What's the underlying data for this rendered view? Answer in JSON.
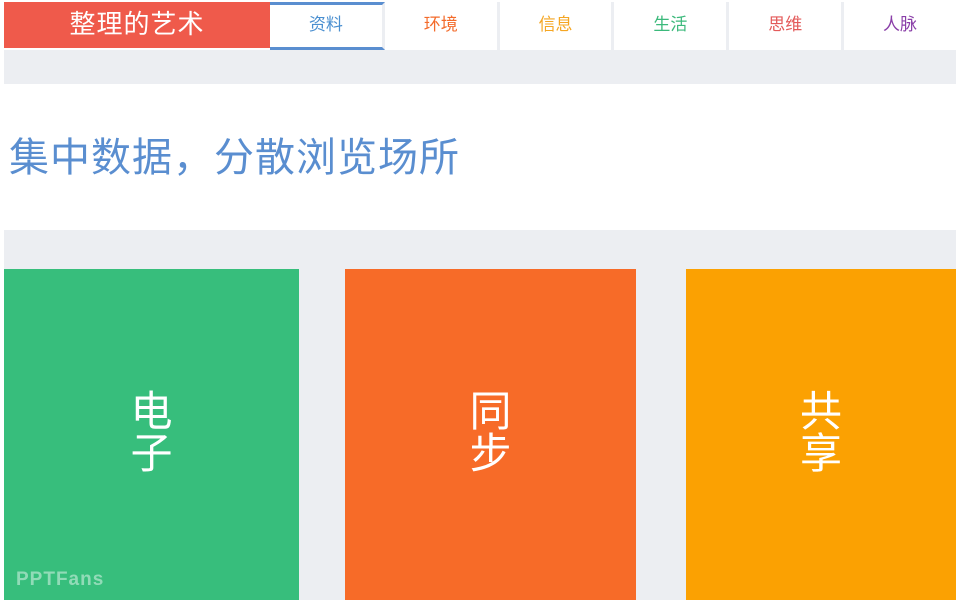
{
  "header": {
    "brand": "整理的艺术",
    "tabs": [
      {
        "label": "资料",
        "color": "#4a8fd0",
        "active": true
      },
      {
        "label": "环境",
        "color": "#f36b2b"
      },
      {
        "label": "信息",
        "color": "#f5a623"
      },
      {
        "label": "生活",
        "color": "#3bb97b"
      },
      {
        "label": "思维",
        "color": "#e35a5a"
      },
      {
        "label": "人脉",
        "color": "#8a3fa8"
      }
    ]
  },
  "main": {
    "heading": "集中数据，分散浏览场所",
    "heading_color": "#5a8ed0",
    "tiles": [
      {
        "label": "电子",
        "color": "#37be7c"
      },
      {
        "label": "同步",
        "color": "#f76b28"
      },
      {
        "label": "共享",
        "color": "#fba102"
      }
    ]
  },
  "watermark": "PPTFans",
  "colors": {
    "brand_bg": "#ef5a4b",
    "band_bg": "#eceef2",
    "active_underline": "#5a8ed0"
  }
}
